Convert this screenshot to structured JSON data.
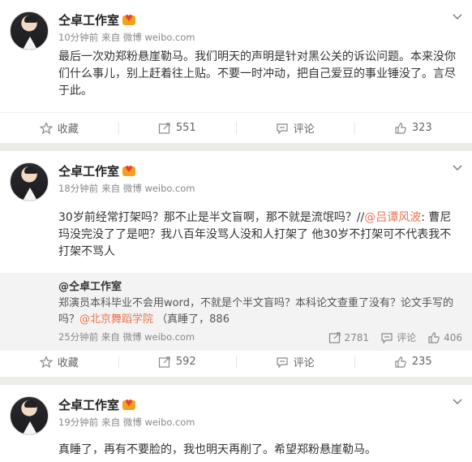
{
  "posts": [
    {
      "author": "仝卓工作室",
      "time": "10分钟前",
      "source": "来自 微博 weibo.com",
      "text": "最后一次劝郑粉悬崖勒马。我们明天的声明是针对黑公关的诉讼问题。本来没你们什么事儿，别上赶着往上贴。不要一时冲动，把自己爱豆的事业锤没了。言尽于此。",
      "actions": {
        "fav": "收藏",
        "repost": "551",
        "comment": "评论",
        "like": "323"
      }
    },
    {
      "author": "仝卓工作室",
      "time": "18分钟前",
      "source": "来自 微博 weibo.com",
      "text_before": "30岁前经常打架吗？那不止是半文盲啊，那不就是流氓吗？//",
      "mention": "@吕谭风波",
      "text_after": ": 曹尼玛没完没了了是吧？我八百年没骂人没和人打架了 他30岁不打架可不代表我不打架不骂人",
      "repost": {
        "author": "@仝卓工作室",
        "text_before": "郑演员本科毕业不会用word，不就是个半文盲吗？本科论文查重了没有？论文手写的吗？",
        "mention": "@北京舞蹈学院",
        "text_after": " （真睡了，886",
        "time": "25分钟前",
        "source": "来自 微博 weibo.com",
        "repost_count": "2781",
        "comment": "评论",
        "like_count": "406"
      },
      "actions": {
        "fav": "收藏",
        "repost": "592",
        "comment": "评论",
        "like": "235"
      }
    },
    {
      "author": "仝卓工作室",
      "time": "19分钟前",
      "source": "来自 微博 weibo.com",
      "text": "真睡了，再有不要脸的，我也明天再削了。希望郑粉悬崖勒马。"
    }
  ]
}
